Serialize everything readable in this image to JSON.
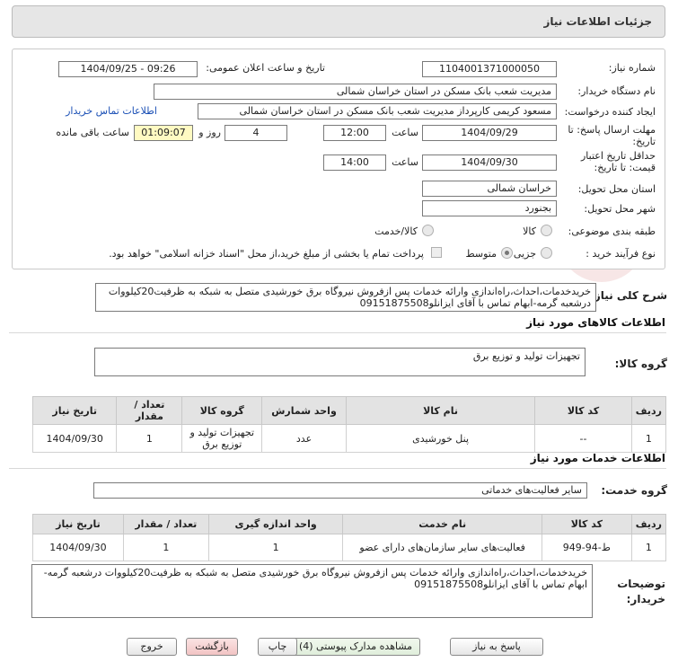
{
  "header": {
    "title": "جزئیات اطلاعات نیاز"
  },
  "form": {
    "need_number_label": "شماره نیاز:",
    "need_number": "1104001371000050",
    "announce_label": "تاریخ و ساعت اعلان عمومی:",
    "announce_value": "1404/09/25 - 09:26",
    "buyer_org_label": "نام دستگاه خریدار:",
    "buyer_org": "مدیریت شعب بانک مسکن در استان خراسان شمالی",
    "requester_label": "ایجاد کننده درخواست:",
    "requester": "مسعود کریمی کارپرداز مدیریت شعب بانک مسکن در استان خراسان شمالی",
    "contact_link": "اطلاعات تماس خریدار",
    "deadline_label_1": "مهلت ارسال پاسخ: تا",
    "deadline_label_2": "تاریخ:",
    "deadline_date": "1404/09/29",
    "time_label": "ساعت",
    "deadline_time": "12:00",
    "days_value": "4",
    "days_label": "روز و",
    "remaining_time": "01:09:07",
    "remaining_label": "ساعت باقی مانده",
    "validity_label_1": "حداقل تاریخ اعتبار",
    "validity_label_2": "قیمت: تا تاریخ:",
    "validity_date": "1404/09/30",
    "validity_time": "14:00",
    "province_label": "استان محل تحویل:",
    "province": "خراسان شمالی",
    "city_label": "شهر محل تحویل:",
    "city": "بجنورد",
    "category_label": "طبقه بندی موضوعی:",
    "category_options": [
      "کالا",
      "کالا/خدمت"
    ],
    "process_label": "نوع فرآیند خرید :",
    "process_options": [
      "جزیی",
      "متوسط"
    ],
    "payment_text": "پرداخت تمام یا بخشی از مبلغ خرید،از محل \"اسناد خزانه اسلامی\" خواهد بود."
  },
  "summary": {
    "label": "شرح کلی نیاز:",
    "text": "خریدخدمات،احداث،راه‌اندازی وارائه خدمات پس ازفروش نیروگاه برق خورشیدی متصل به شبکه به ظرفیت20کیلووات درشعبه گرمه-ابهام تماس با آقای ایزانلو09151875508"
  },
  "goods": {
    "section_title": "اطلاعات کالاهای مورد نیاز",
    "group_label": "گروه کالا:",
    "group_value": "تجهیزات تولید و توزیع برق",
    "columns": [
      "ردیف",
      "کد کالا",
      "نام کالا",
      "واحد شمارش",
      "گروه کالا",
      "تعداد / مقدار",
      "تاریخ نیاز"
    ],
    "rows": [
      [
        "1",
        "--",
        "پنل خورشیدی",
        "عدد",
        "تجهیزات تولید و توزیع برق",
        "1",
        "1404/09/30"
      ]
    ]
  },
  "services": {
    "section_title": "اطلاعات خدمات مورد نیاز",
    "group_label": "گروه خدمت:",
    "group_value": "سایر فعالیت‌های خدماتی",
    "columns": [
      "ردیف",
      "کد کالا",
      "نام خدمت",
      "واحد اندازه گیری",
      "تعداد / مقدار",
      "تاریخ نیاز"
    ],
    "rows": [
      [
        "1",
        "ط-94-949",
        "فعالیت‌های سایر سازمان‌های دارای عضو",
        "1",
        "1",
        "1404/09/30"
      ]
    ]
  },
  "buyer_notes": {
    "label_1": "توضیحات",
    "label_2": "خریدار:",
    "text": "خریدخدمات،احداث،راه‌اندازی وارائه خدمات پس ازفروش نیروگاه برق خورشیدی متصل به شبکه به ظرفیت20کیلووات درشعبه گرمه-ابهام تماس با آقای ایزانلو09151875508"
  },
  "buttons": {
    "reply": "پاسخ به نیاز",
    "attachments": "مشاهده مدارک پیوستی (4)",
    "print": "چاپ",
    "back": "بازگشت",
    "exit": "خروج"
  },
  "colors": {
    "highlight": "#fffac2",
    "link": "#1a4fb5",
    "header_bg": "#e6e6e6"
  }
}
